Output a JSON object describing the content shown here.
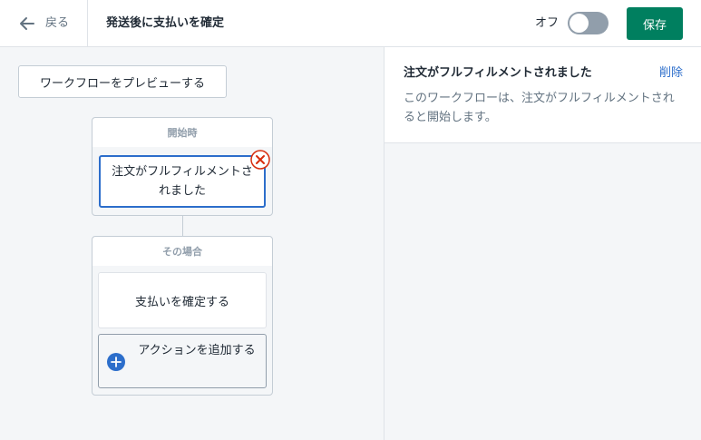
{
  "header": {
    "back_label": "戻る",
    "title": "発送後に支払いを確定",
    "toggle_label": "オフ",
    "toggle_on": false,
    "save_label": "保存"
  },
  "workflow": {
    "preview_label": "ワークフローをプレビューする",
    "trigger_section_label": "開始時",
    "trigger_label": "注文がフルフィルメントされました",
    "action_section_label": "その場合",
    "action_label": "支払いを確定する",
    "add_action_label": "アクションを追加する"
  },
  "detail": {
    "title": "注文がフルフィルメントされました",
    "delete_label": "削除",
    "description": "このワークフローは、注文がフルフィルメントされると開始します。"
  },
  "colors": {
    "primary": "#007f5f",
    "selection": "#2c6ecb",
    "danger": "#d72c0d"
  },
  "icons": {
    "back": "arrow-left-icon",
    "remove": "close-circle-icon",
    "add": "plus-circle-icon"
  }
}
